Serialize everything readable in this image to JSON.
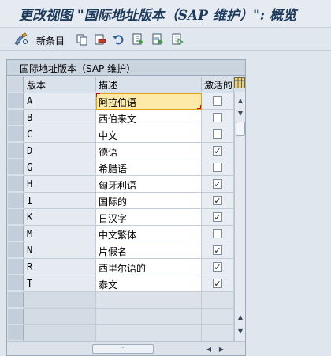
{
  "title": "更改视图 \"国际地址版本（SAP 维护）\": 概览",
  "toolbar": {
    "new_entries_label": "新条目",
    "icons": [
      "display-change-icon",
      "copy-icon",
      "delete-icon",
      "undo-icon",
      "select-all-icon",
      "select-block-icon",
      "deselect-all-icon"
    ]
  },
  "table": {
    "title": "国际地址版本（SAP 维护）",
    "columns": {
      "version": "版本",
      "description": "描述",
      "active": "激活的"
    },
    "rows": [
      {
        "key": "A",
        "desc": "阿拉伯语",
        "active": false
      },
      {
        "key": "B",
        "desc": "西伯来文",
        "active": false
      },
      {
        "key": "C",
        "desc": "中文",
        "active": false
      },
      {
        "key": "D",
        "desc": "德语",
        "active": true
      },
      {
        "key": "G",
        "desc": "希腊语",
        "active": false
      },
      {
        "key": "H",
        "desc": "匈牙利语",
        "active": true
      },
      {
        "key": "I",
        "desc": "国际的",
        "active": true
      },
      {
        "key": "K",
        "desc": "日汉字",
        "active": true
      },
      {
        "key": "M",
        "desc": "中文繁体",
        "active": false
      },
      {
        "key": "N",
        "desc": "片假名",
        "active": true
      },
      {
        "key": "R",
        "desc": "西里尔语的",
        "active": true
      },
      {
        "key": "T",
        "desc": "泰文",
        "active": true
      }
    ]
  },
  "colors": {
    "title_text": "#1d3a5c",
    "focus_cell": "#fdeaa8",
    "panel_bg": "#d8e0e9"
  }
}
